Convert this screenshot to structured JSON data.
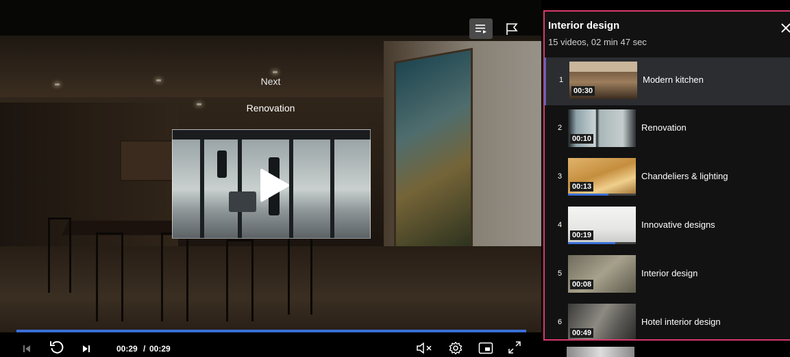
{
  "overlay": {
    "next_label": "Next",
    "next_title": "Renovation"
  },
  "controls": {
    "time_current": "00:29",
    "time_separator": "/",
    "time_total": "00:29",
    "progress_fraction": 1.0,
    "icons": [
      "skip-back-icon",
      "replay-icon",
      "skip-next-icon",
      "mute-icon",
      "settings-icon",
      "miniplayer-icon",
      "fullscreen-icon"
    ]
  },
  "topbar": {
    "icons": [
      "playlist-icon",
      "flag-icon"
    ]
  },
  "playlist": {
    "title": "Interior design",
    "meta": "15 videos, 02 min 47 sec",
    "items": [
      {
        "num": "1",
        "duration": "00:30",
        "title": "Modern kitchen",
        "active": true,
        "progress": 0
      },
      {
        "num": "2",
        "duration": "00:10",
        "title": "Renovation",
        "active": false,
        "progress": 0
      },
      {
        "num": "3",
        "duration": "00:13",
        "title": "Chandeliers & lighting",
        "active": false,
        "progress": 0.6
      },
      {
        "num": "4",
        "duration": "00:19",
        "title": "Innovative designs",
        "active": false,
        "progress": 0.7
      },
      {
        "num": "5",
        "duration": "00:08",
        "title": "Interior design",
        "active": false,
        "progress": 0
      },
      {
        "num": "6",
        "duration": "00:49",
        "title": "Hotel interior design",
        "active": false,
        "progress": 0
      }
    ]
  },
  "colors": {
    "accent": "#3a6fd6",
    "panel_border": "#d83a6c",
    "panel_bg": "#121212"
  }
}
